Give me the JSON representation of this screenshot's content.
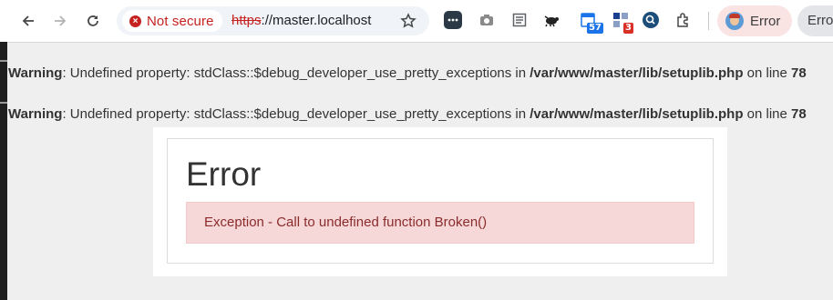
{
  "browser": {
    "security_label": "Not secure",
    "url_scheme": "https",
    "url_rest": "://master.localhost",
    "extensions": [
      {
        "icon": "chat-bubble-icon"
      },
      {
        "icon": "camera-icon"
      },
      {
        "icon": "reader-icon"
      },
      {
        "icon": "turtle-icon"
      },
      {
        "icon": "calendar-icon",
        "badge": "57"
      },
      {
        "icon": "grid-icon",
        "badge": "3"
      },
      {
        "icon": "magnifier-icon"
      },
      {
        "icon": "puzzle-icon"
      }
    ],
    "profile_label": "Error",
    "second_chip_label": "Error"
  },
  "warnings": [
    {
      "label": "Warning",
      "message": ": Undefined property: stdClass::$debug_developer_use_pretty_exceptions in ",
      "file": "/var/www/master/lib/setuplib.php",
      "on_line": " on line ",
      "line": "78"
    },
    {
      "label": "Warning",
      "message": ": Undefined property: stdClass::$debug_developer_use_pretty_exceptions in ",
      "file": "/var/www/master/lib/setuplib.php",
      "on_line": " on line ",
      "line": "78"
    }
  ],
  "error_card": {
    "title": "Error",
    "message": "Exception - Call to undefined function Broken()"
  },
  "colors": {
    "insecure_red": "#c5221f",
    "alert_bg": "#f6d8d9",
    "alert_text": "#8b2b2b",
    "calendar_badge": "#1a73e8",
    "grid_badge": "#d93025"
  }
}
